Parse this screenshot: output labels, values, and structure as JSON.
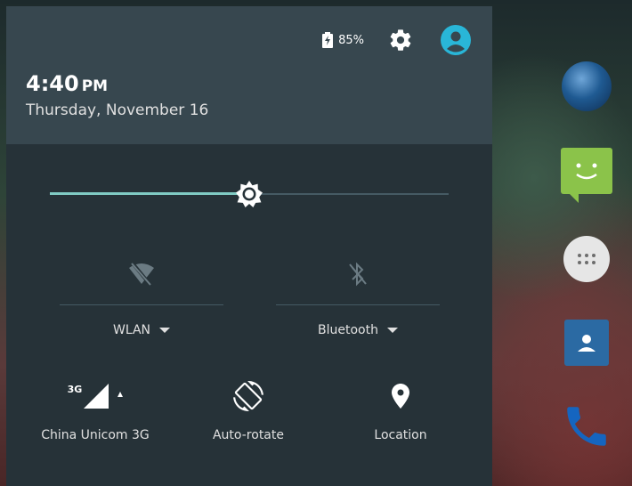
{
  "header": {
    "battery_percent": "85%",
    "time": "4:40",
    "ampm": "PM",
    "date": "Thursday, November 16"
  },
  "brightness": {
    "level": 0.5
  },
  "tiles": {
    "wlan": {
      "label": "WLAN",
      "icon": "wifi-off-icon"
    },
    "bluetooth": {
      "label": "Bluetooth",
      "icon": "bluetooth-disabled-icon"
    },
    "mobile": {
      "label": "China Unicom 3G",
      "badge": "3G",
      "icon": "cell-signal-icon"
    },
    "rotate": {
      "label": "Auto-rotate",
      "icon": "screen-rotation-icon"
    },
    "location": {
      "label": "Location",
      "icon": "location-pin-icon"
    }
  },
  "colors": {
    "accent": "#80cbc4",
    "header_bg": "#37474f",
    "panel_bg": "#263238",
    "user_icon": "#29b6d8"
  }
}
